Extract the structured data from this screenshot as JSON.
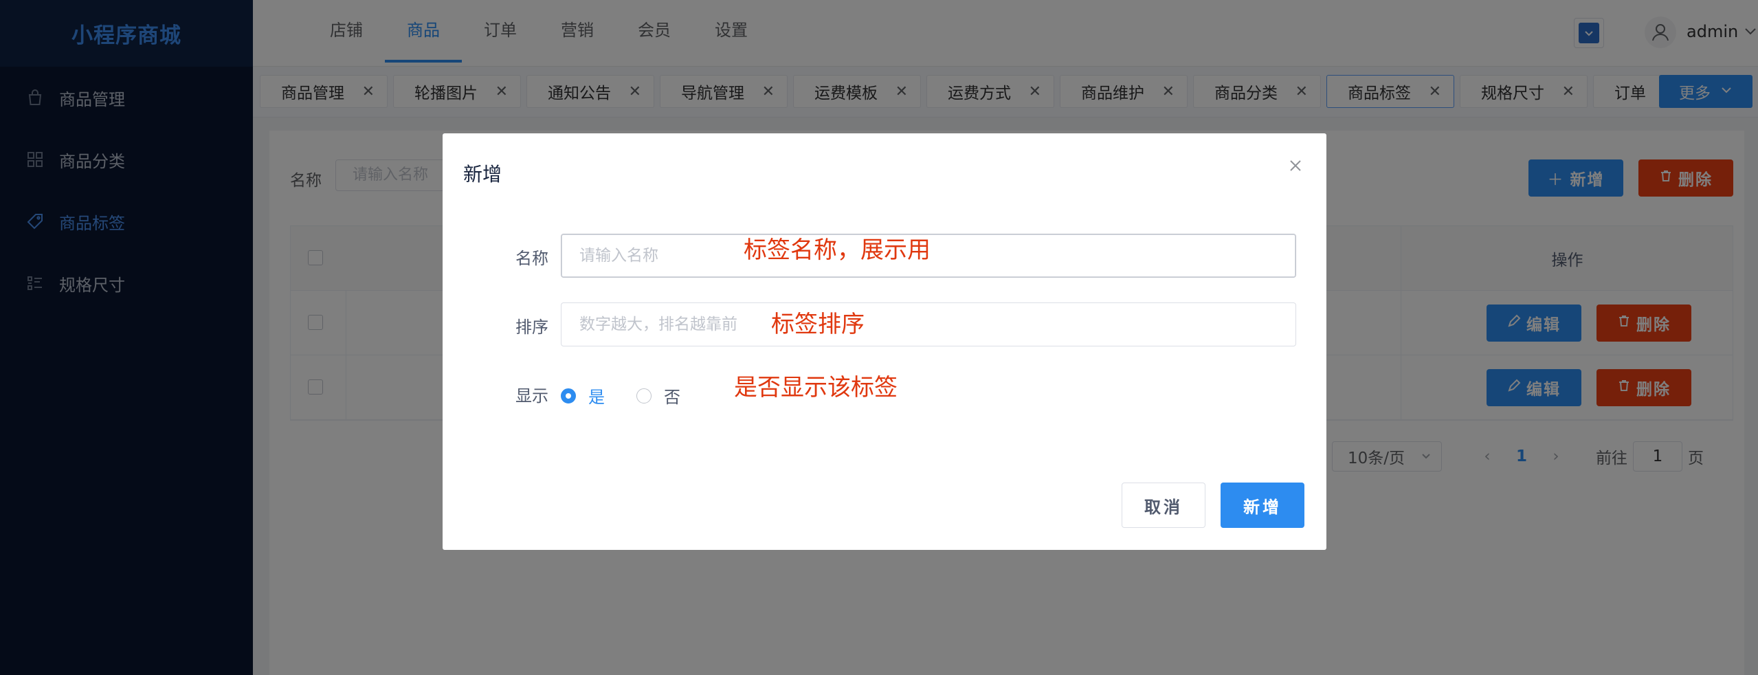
{
  "app": {
    "logo": "小程序商城"
  },
  "sidebar": {
    "items": [
      {
        "label": "商品管理",
        "icon": "shopping-bag-icon"
      },
      {
        "label": "商品分类",
        "icon": "grid-icon"
      },
      {
        "label": "商品标签",
        "icon": "tag-icon",
        "active": true
      },
      {
        "label": "规格尺寸",
        "icon": "list-icon"
      }
    ]
  },
  "header": {
    "nav": [
      "店铺",
      "商品",
      "订单",
      "营销",
      "会员",
      "设置"
    ],
    "active_nav": "商品",
    "user": "admin"
  },
  "tabs": {
    "items": [
      "商品管理",
      "轮播图片",
      "通知公告",
      "导航管理",
      "运费模板",
      "运费方式",
      "商品维护",
      "商品分类",
      "商品标签",
      "规格尺寸",
      "订单"
    ],
    "active": "商品标签",
    "more": "更多"
  },
  "content": {
    "search_label": "名称",
    "search_placeholder": "请输入名称",
    "add_btn": "新增",
    "delete_btn": "删除",
    "table": {
      "op_header": "操作",
      "edit_btn": "编辑",
      "delete_btn": "删除"
    },
    "pager": {
      "size": "10条/页",
      "current": "1",
      "goto": "前往",
      "goto_value": "1",
      "page": "页"
    }
  },
  "modal": {
    "title": "新增",
    "name_label": "名称",
    "name_placeholder": "请输入名称",
    "name_note": "标签名称，展示用",
    "sort_label": "排序",
    "sort_placeholder": "数字越大，排名越靠前",
    "sort_note": "标签排序",
    "show_label": "显示",
    "show_yes": "是",
    "show_no": "否",
    "show_note": "是否显示该标签",
    "cancel": "取消",
    "submit": "新增"
  }
}
